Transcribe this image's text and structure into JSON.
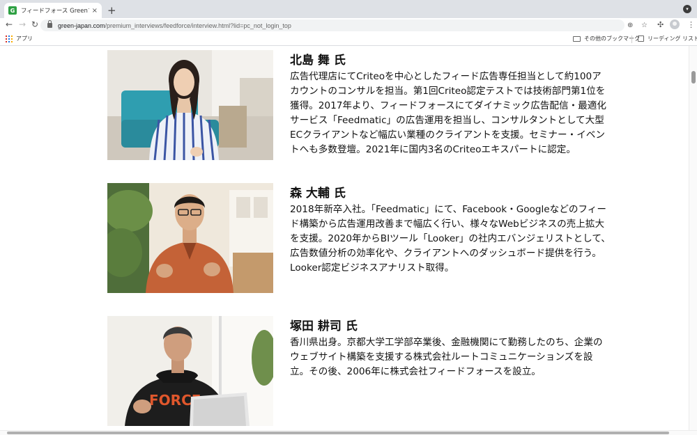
{
  "browser": {
    "tab_title": "フィードフォース Greenプレミアム",
    "tab_close": "×",
    "new_tab": "+",
    "url_host": "green-japan.com",
    "url_path": "/premium_interviews/feedforce/interview.html?lid=pc_not_login_top",
    "back": "←",
    "forward": "→",
    "reload": "↻",
    "menu": "⋮",
    "bookmarks": {
      "apps_label": "アプリ",
      "other_label": "その他のブックマーク",
      "reading_label": "リーディング リスト"
    }
  },
  "people": [
    {
      "name": "北島 舞 氏",
      "bio": "広告代理店にてCriteoを中心としたフィード広告専任担当として約100アカウントのコンサルを担当。第1回Criteo認定テストでは技術部門第1位を獲得。2017年より、フィードフォースにてダイナミック広告配信・最適化サービス「Feedmatic」の広告運用を担当し、コンサルタントとして大型ECクライアントなど幅広い業種のクライアントを支援。セミナー・イベントへも多数登壇。2021年に国内3名のCriteoエキスパートに認定。"
    },
    {
      "name": "森 大輔 氏",
      "bio": "2018年新卒入社。「Feedmatic」にて、Facebook・Googleなどのフィード構築から広告運用改善まで幅広く行い、様々なWebビジネスの売上拡大を支援。2020年からBIツール「Looker」の社内エバンジェリストとして、広告数値分析の効率化や、クライアントへのダッシュボード提供を行う。Looker認定ビジネスアナリスト取得。"
    },
    {
      "name": "塚田 耕司 氏",
      "bio": "香川県出身。京都大学工学部卒業後、金融機関にて勤務したのち、企業のウェブサイト構築を支援する株式会社ルートコミュニケーションズを設立。その後、2006年に株式会社フィードフォースを設立。",
      "shirt_text": "FORCE"
    }
  ]
}
